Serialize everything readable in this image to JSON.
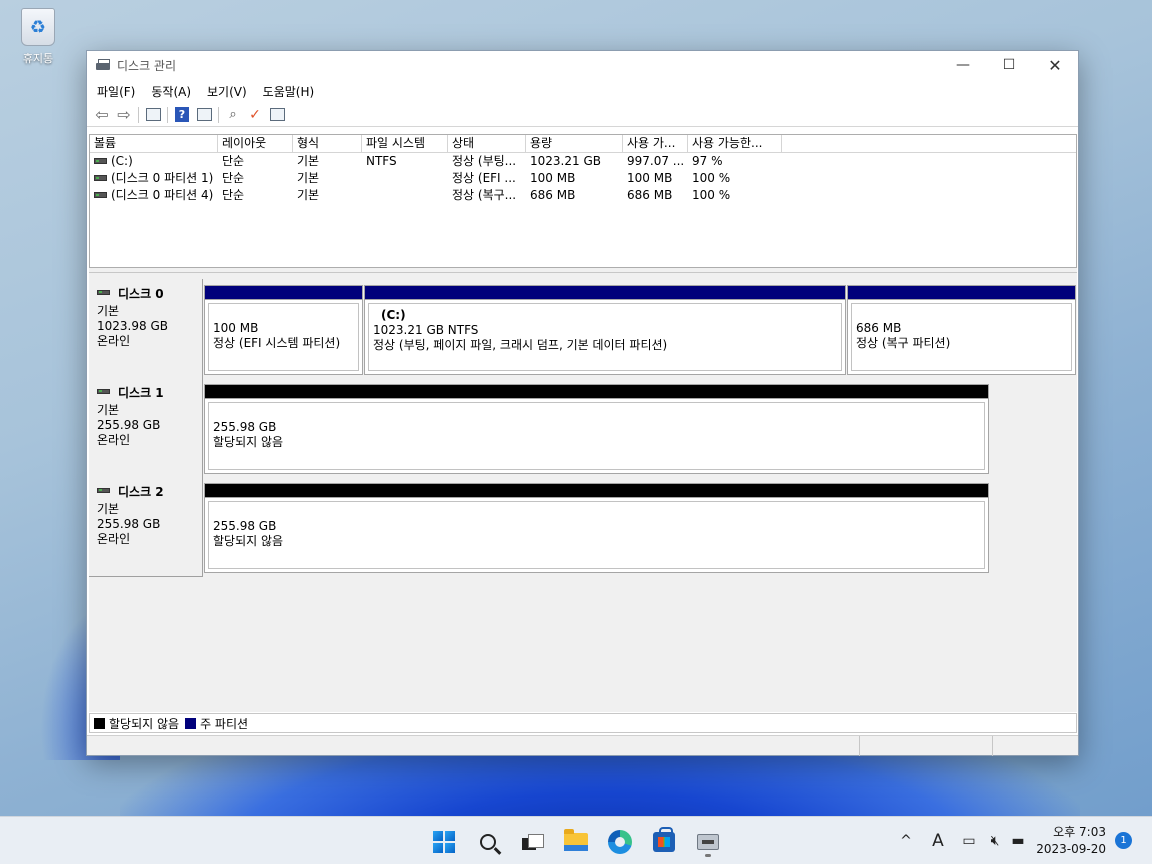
{
  "desktop": {
    "recycle_bin_label": "휴지통"
  },
  "window": {
    "title": "디스크 관리",
    "controls": {
      "minimize": "—",
      "maximize": "☐",
      "close": "✕"
    }
  },
  "menu": [
    "파일(F)",
    "동작(A)",
    "보기(V)",
    "도움말(H)"
  ],
  "volume_list": {
    "columns": [
      "볼륨",
      "레이아웃",
      "형식",
      "파일 시스템",
      "상태",
      "용량",
      "사용 가...",
      "사용 가능한..."
    ],
    "rows": [
      [
        "(C:)",
        "단순",
        "기본",
        "NTFS",
        "정상 (부팅...",
        "1023.21 GB",
        "997.07 ...",
        "97 %"
      ],
      [
        "(디스크 0 파티션 1)",
        "단순",
        "기본",
        "",
        "정상 (EFI ...",
        "100 MB",
        "100 MB",
        "100 %"
      ],
      [
        "(디스크 0 파티션 4)",
        "단순",
        "기본",
        "",
        "정상 (복구...",
        "686 MB",
        "686 MB",
        "100 %"
      ]
    ]
  },
  "disks": [
    {
      "name": "디스크 0",
      "type": "기본",
      "size": "1023.98 GB",
      "status": "온라인",
      "partitions": [
        {
          "title": "",
          "line1": "100 MB",
          "line2": "정상 (EFI 시스템 파티션)",
          "kind": "primary"
        },
        {
          "title": "(C:)",
          "line1": "1023.21 GB NTFS",
          "line2": "정상 (부팅, 페이지 파일, 크래시 덤프, 기본 데이터 파티션)",
          "kind": "primary"
        },
        {
          "title": "",
          "line1": "686 MB",
          "line2": "정상 (복구 파티션)",
          "kind": "primary"
        }
      ]
    },
    {
      "name": "디스크 1",
      "type": "기본",
      "size": "255.98 GB",
      "status": "온라인",
      "partitions": [
        {
          "title": "",
          "line1": "255.98 GB",
          "line2": "할당되지 않음",
          "kind": "unallocated"
        }
      ]
    },
    {
      "name": "디스크 2",
      "type": "기본",
      "size": "255.98 GB",
      "status": "온라인",
      "partitions": [
        {
          "title": "",
          "line1": "255.98 GB",
          "line2": "할당되지 않음",
          "kind": "unallocated"
        }
      ]
    }
  ],
  "legend": {
    "unallocated": "할당되지 않음",
    "primary": "주 파티션"
  },
  "colors": {
    "primary_partition": "#00007b",
    "unallocated": "#000000"
  },
  "taskbar": {
    "icons": [
      "windows-start-icon",
      "search-icon",
      "task-view-icon",
      "file-explorer-icon",
      "edge-icon",
      "store-icon",
      "disk-management-icon"
    ],
    "clock_time": "오후 7:03",
    "clock_date": "2023-09-20",
    "notification_count": "1",
    "tray": {
      "chevron": "^",
      "ime": "A"
    }
  }
}
